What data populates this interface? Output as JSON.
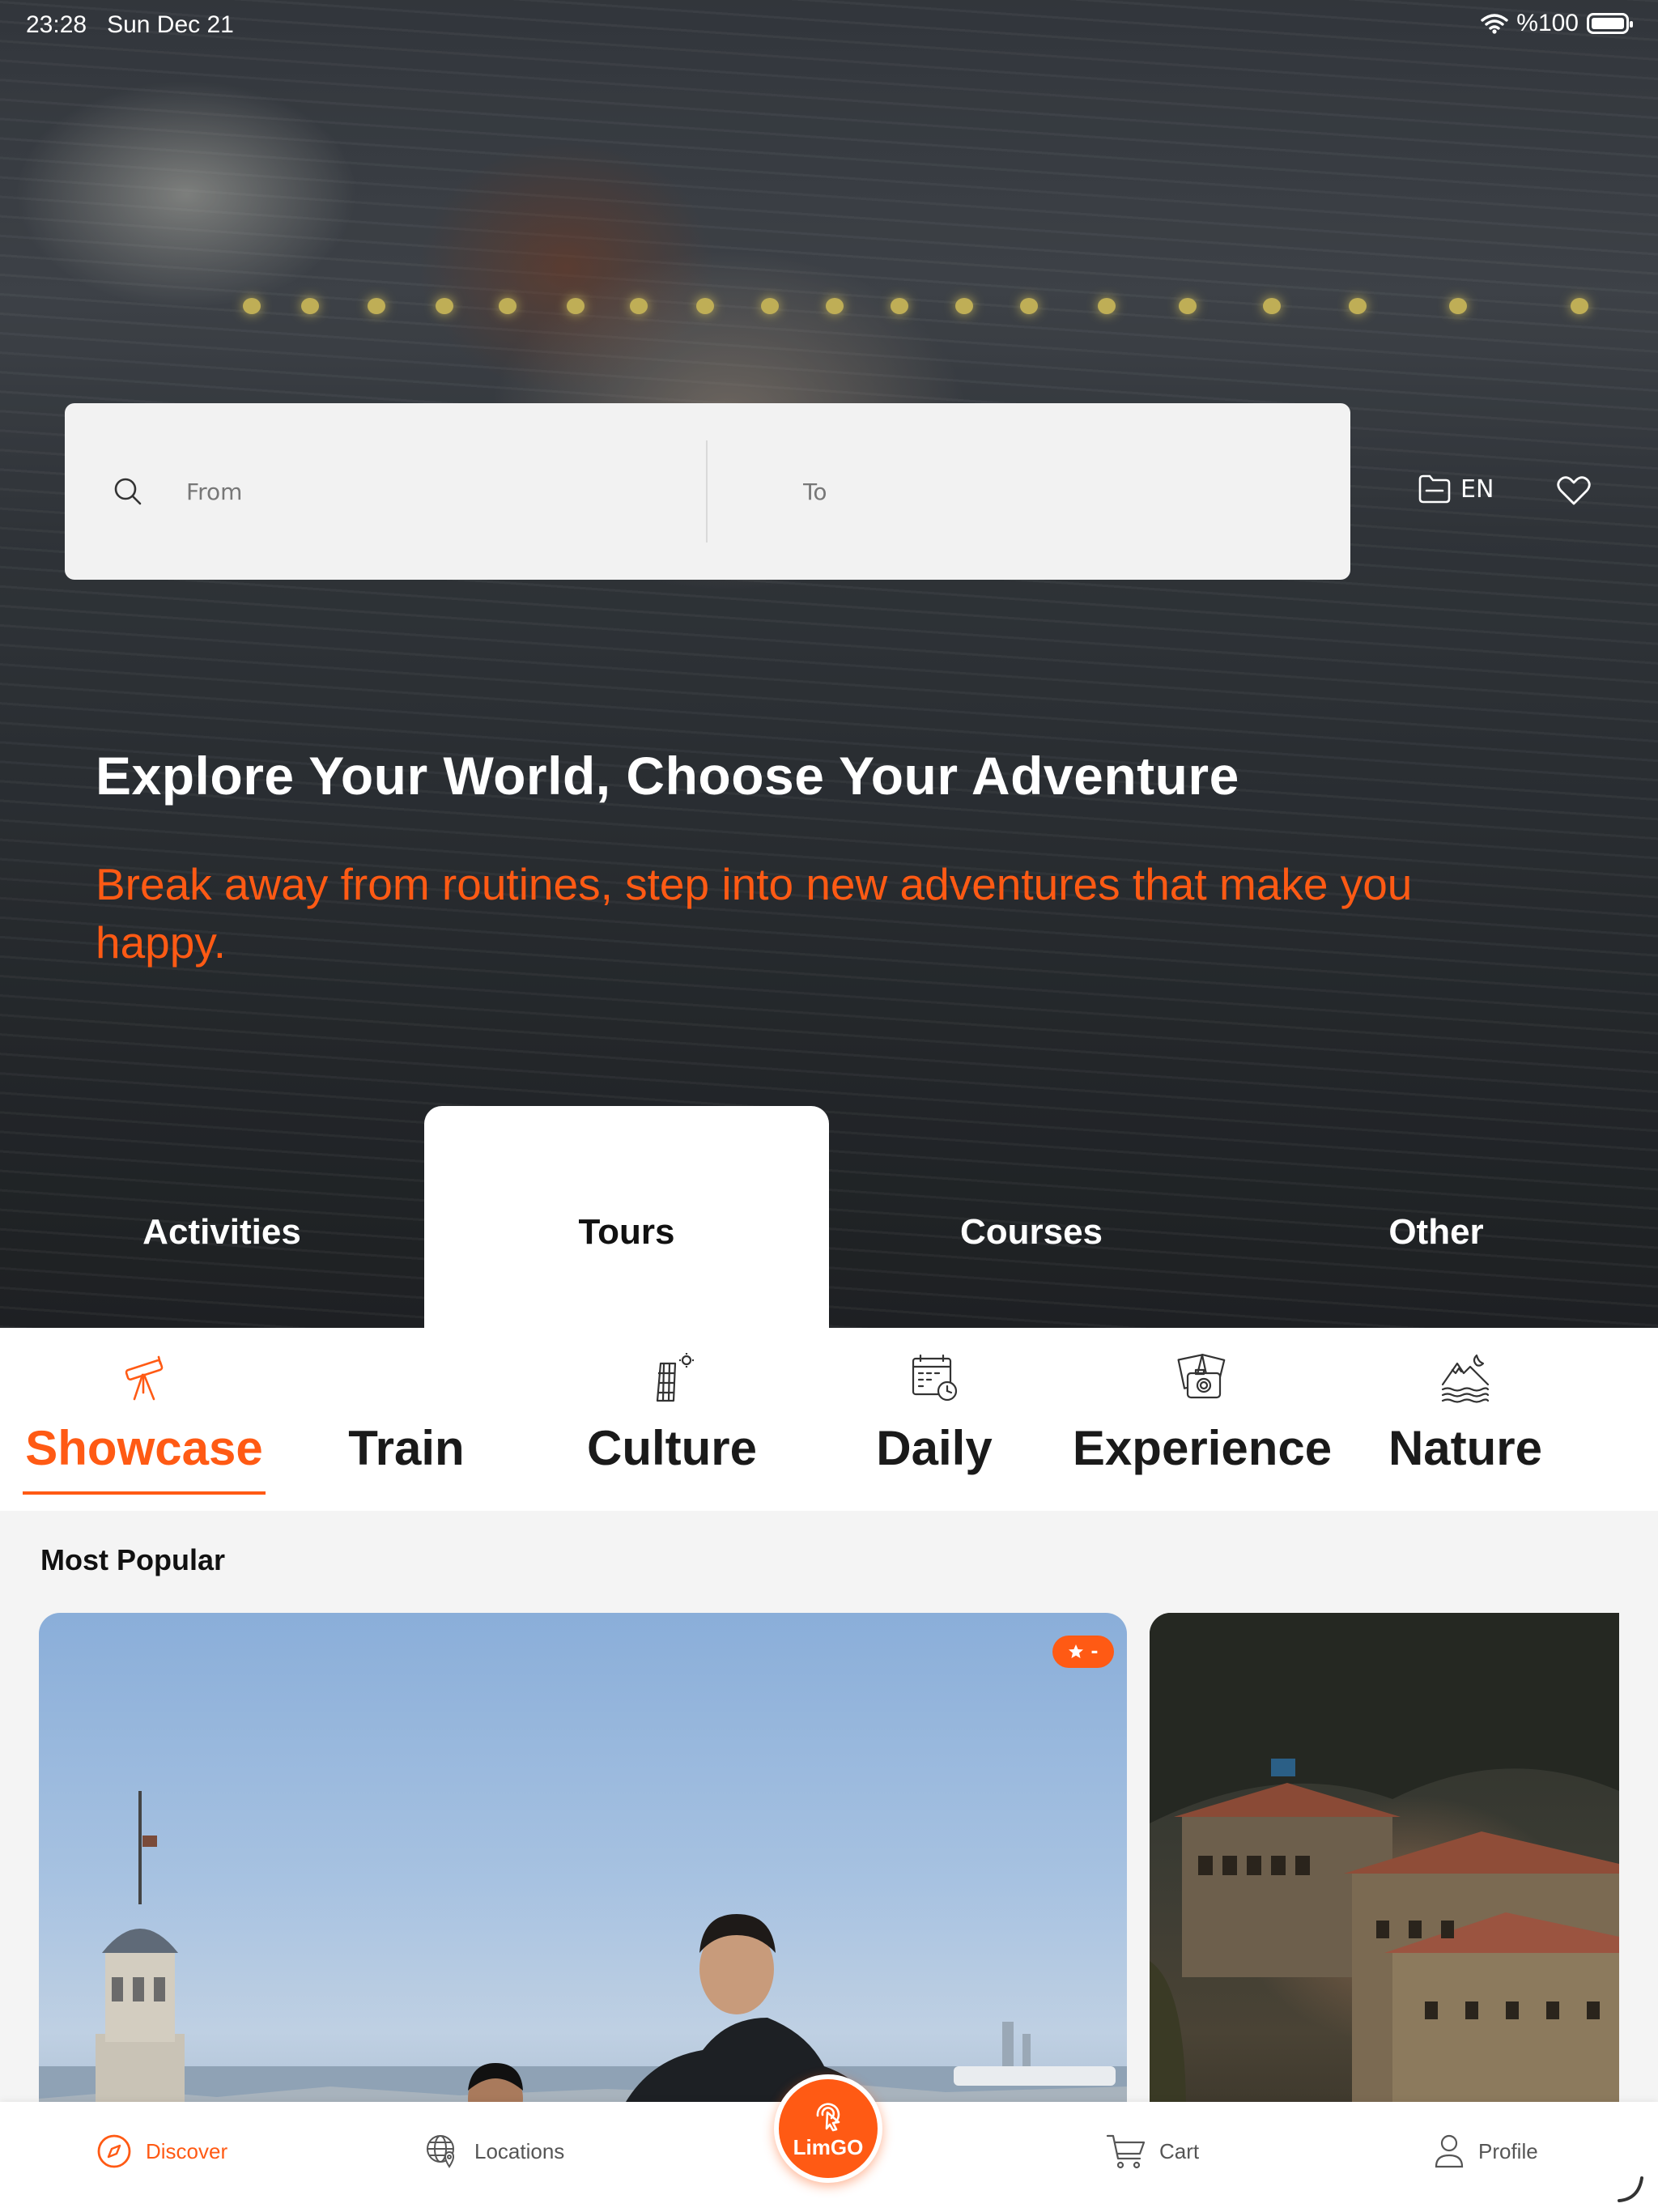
{
  "status_bar": {
    "time": "23:28",
    "date": "Sun Dec 21",
    "battery": "%100"
  },
  "search": {
    "from_placeholder": "From",
    "to_placeholder": "To"
  },
  "header": {
    "language": "EN"
  },
  "hero": {
    "title": "Explore Your World, Choose Your Adventure",
    "subtitle": "Break away from routines, step into new adventures that make you happy."
  },
  "main_tabs": [
    {
      "label": "Activities",
      "active": false
    },
    {
      "label": "Tours",
      "active": true
    },
    {
      "label": "Courses",
      "active": false
    },
    {
      "label": "Other",
      "active": false
    }
  ],
  "subcategories": [
    {
      "label": "Showcase",
      "icon": "telescope-icon",
      "active": true
    },
    {
      "label": "Train",
      "icon": "train-icon",
      "active": false
    },
    {
      "label": "Culture",
      "icon": "leaning-tower-icon",
      "active": false
    },
    {
      "label": "Daily",
      "icon": "calendar-clock-icon",
      "active": false
    },
    {
      "label": "Experience",
      "icon": "camera-photos-icon",
      "active": false
    },
    {
      "label": "Nature",
      "icon": "mountain-sea-icon",
      "active": false
    }
  ],
  "section": {
    "title": "Most Popular"
  },
  "cards": [
    {
      "rating": "-"
    },
    {}
  ],
  "bottom_nav": {
    "discover": "Discover",
    "locations": "Locations",
    "limgo": "LimGO",
    "cart": "Cart",
    "profile": "Profile"
  },
  "colors": {
    "accent": "#ff5a14",
    "search_bg": "#f2f2f2",
    "content_bg": "#f4f4f4"
  }
}
